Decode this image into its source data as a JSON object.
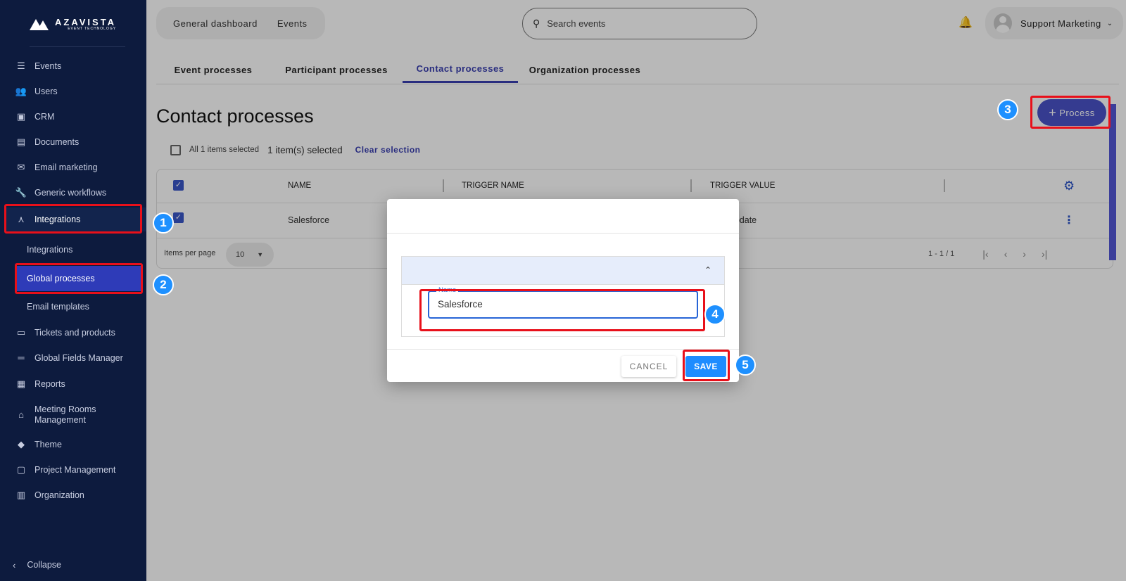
{
  "brand": {
    "name": "AZAVISTA",
    "tagline": "EVENT TECHNOLOGY"
  },
  "sidebar": {
    "items": [
      {
        "label": "Events",
        "icon": "list-icon"
      },
      {
        "label": "Users",
        "icon": "users-icon"
      },
      {
        "label": "CRM",
        "icon": "contact-card-icon"
      },
      {
        "label": "Documents",
        "icon": "document-icon"
      },
      {
        "label": "Email marketing",
        "icon": "mail-icon"
      },
      {
        "label": "Generic workflows",
        "icon": "wrench-icon"
      },
      {
        "label": "Integrations",
        "icon": "hub-icon"
      },
      {
        "label": "Tickets and products",
        "icon": "credit-card-icon"
      },
      {
        "label": "Global Fields Manager",
        "icon": "fields-icon"
      },
      {
        "label": "Reports",
        "icon": "bar-chart-icon"
      },
      {
        "label": "Meeting Rooms Management",
        "icon": "store-icon"
      },
      {
        "label": "Theme",
        "icon": "palette-icon"
      },
      {
        "label": "Project Management",
        "icon": "calendar-icon"
      },
      {
        "label": "Organization",
        "icon": "building-icon"
      }
    ],
    "sub_items": [
      {
        "label": "Integrations"
      },
      {
        "label": "Global processes"
      },
      {
        "label": "Email templates"
      }
    ],
    "collapse_label": "Collapse"
  },
  "header": {
    "breadcrumbs": [
      "General dashboard",
      "Events"
    ],
    "search_placeholder": "Search events",
    "user_name": "Support Marketing"
  },
  "tabs": [
    "Event processes",
    "Participant processes",
    "Contact processes",
    "Organization processes"
  ],
  "active_tab": "Contact processes",
  "page_title": "Contact processes",
  "add_button_label": "Process",
  "selection": {
    "all_label": "All 1 items selected",
    "count_label": "1 item(s) selected",
    "clear_label": "Clear selection"
  },
  "table": {
    "columns": [
      "NAME",
      "TRIGGER NAME",
      "TRIGGER VALUE"
    ],
    "rows": [
      {
        "name": "Salesforce",
        "trigger_value_visible": "e, update"
      }
    ],
    "items_per_page_label": "Items per page",
    "items_per_page_value": "10",
    "range_label": "1 - 1 / 1"
  },
  "dialog": {
    "field_label": "Name",
    "field_value": "Salesforce",
    "cancel_label": "CANCEL",
    "save_label": "SAVE"
  },
  "annotations": [
    "1",
    "2",
    "3",
    "4",
    "5"
  ],
  "colors": {
    "sidebar_bg": "#0d1b3e",
    "accent": "#3a3fb0",
    "highlight": "#e8101a",
    "badge": "#1e90ff",
    "save_button": "#1e8cff"
  }
}
